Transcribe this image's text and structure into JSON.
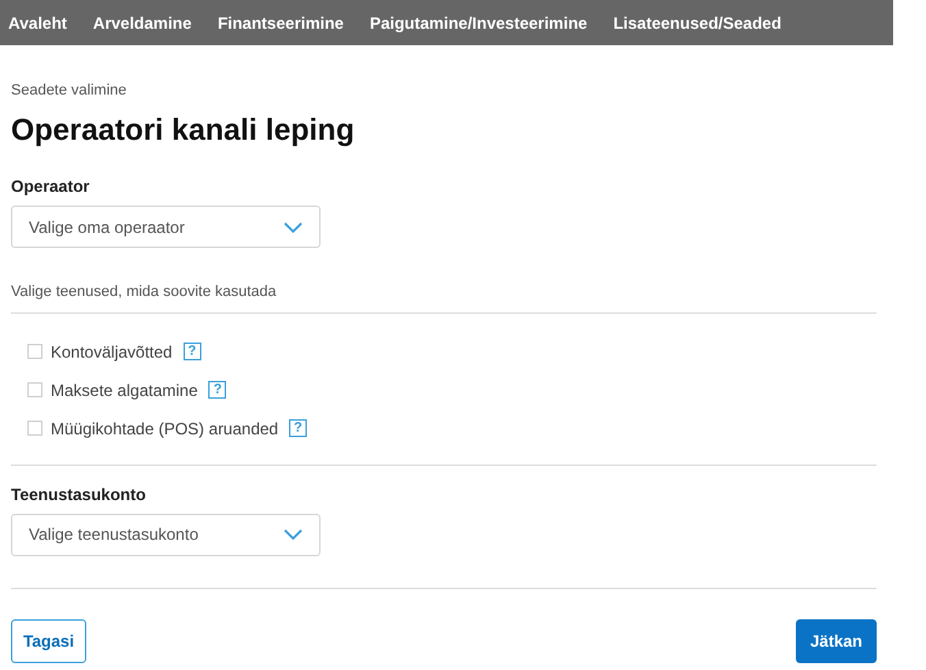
{
  "nav": [
    {
      "label": "Avaleht"
    },
    {
      "label": "Arveldamine"
    },
    {
      "label": "Finantseerimine"
    },
    {
      "label": "Paigutamine/Investeerimine"
    },
    {
      "label": "Lisateenused/Seaded"
    }
  ],
  "breadcrumb": "Seadete valimine",
  "title": "Operaatori kanali leping",
  "operator": {
    "label": "Operaator",
    "placeholder": "Valige oma operaator"
  },
  "services_prompt": "Valige teenused, mida soovite kasutada",
  "services": [
    {
      "label": "Kontoväljavõtted",
      "checked": false,
      "help": "?"
    },
    {
      "label": "Maksete algatamine",
      "checked": false,
      "help": "?"
    },
    {
      "label": "Müügikohtade (POS) aruanded",
      "checked": false,
      "help": "?"
    }
  ],
  "account": {
    "label": "Teenustasukonto",
    "placeholder": "Valige teenustasukonto"
  },
  "buttons": {
    "back": "Tagasi",
    "next": "Jätkan"
  }
}
